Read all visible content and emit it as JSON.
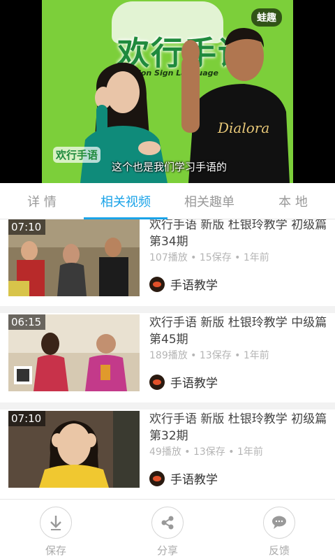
{
  "player": {
    "logo_text": "欢行手语",
    "logo_subtitle": "Fashion Sign Language",
    "watermark": "欢行手语",
    "subtitle": "这个也是我们学习手语的",
    "brand_badge": "蛙趣",
    "shirt_text": "Dialora"
  },
  "tabs": [
    {
      "label": "详 情",
      "active": false
    },
    {
      "label": "相关视频",
      "active": true
    },
    {
      "label": "相关趣单",
      "active": false
    },
    {
      "label": "本 地",
      "active": false
    }
  ],
  "videos": [
    {
      "duration": "07:10",
      "title": "欢行手语 新版 杜银玲教学 初级篇 第34期",
      "meta": "107播放 • 15保存 • 1年前",
      "author": "手语教学"
    },
    {
      "duration": "06:15",
      "title": "欢行手语 新版 杜银玲教学 中级篇 第45期",
      "meta": "189播放 • 13保存 • 1年前",
      "author": "手语教学"
    },
    {
      "duration": "07:10",
      "title": "欢行手语 新版 杜银玲教学 初级篇 第32期",
      "meta": "49播放 • 13保存 • 1年前",
      "author": "手语教学"
    }
  ],
  "actions": [
    {
      "label": "保存",
      "icon": "download-icon"
    },
    {
      "label": "分享",
      "icon": "share-icon"
    },
    {
      "label": "反馈",
      "icon": "feedback-icon"
    }
  ],
  "colors": {
    "accent": "#1aa3e8",
    "player_background": "#7ccf3a"
  }
}
